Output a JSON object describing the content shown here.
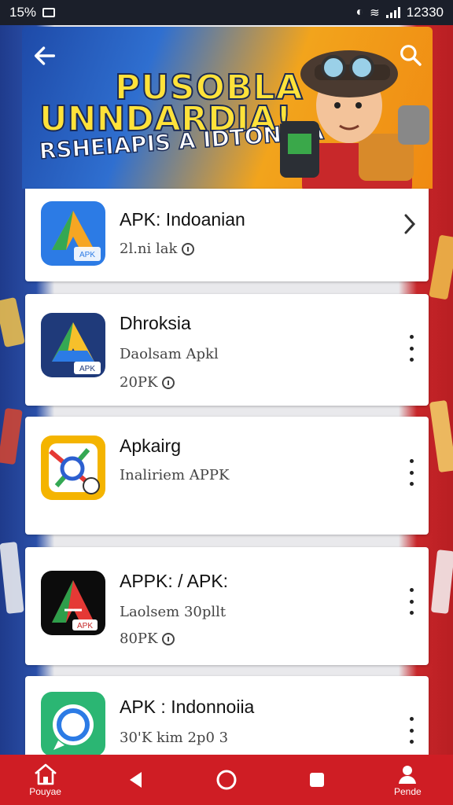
{
  "status_bar": {
    "battery": "15%",
    "time": "12330"
  },
  "banner": {
    "line1": "PUSOBLA",
    "line2": "UNNDARDIA!",
    "line3": "RSHEIAPIS A IDTONAIA"
  },
  "apps": [
    {
      "name": "APK: Indoanian",
      "meta1": "2l.ni lak",
      "meta2": "",
      "action": "chevron"
    },
    {
      "name": "Dhroksia",
      "meta1": "Daolsam Apkl",
      "meta2": "20PK",
      "action": "more"
    },
    {
      "name": "Apkairg",
      "meta1": "Inaliriem APPK",
      "meta2": "",
      "action": "more"
    },
    {
      "name": "APPK: / APK:",
      "meta1": "Laolsem 30pllt",
      "meta2": "80PK",
      "action": "more"
    },
    {
      "name": "APK : Indonnoiia",
      "meta1": "30'K kim 2p0 3",
      "meta2": "",
      "action": "more"
    }
  ],
  "icon_badges": {
    "apk": "APK"
  },
  "bottom_nav": {
    "home_label": "Pouyae",
    "profile_label": "Pende"
  },
  "colors": {
    "nav": "#cf1d24",
    "status": "#1b1f2a"
  }
}
